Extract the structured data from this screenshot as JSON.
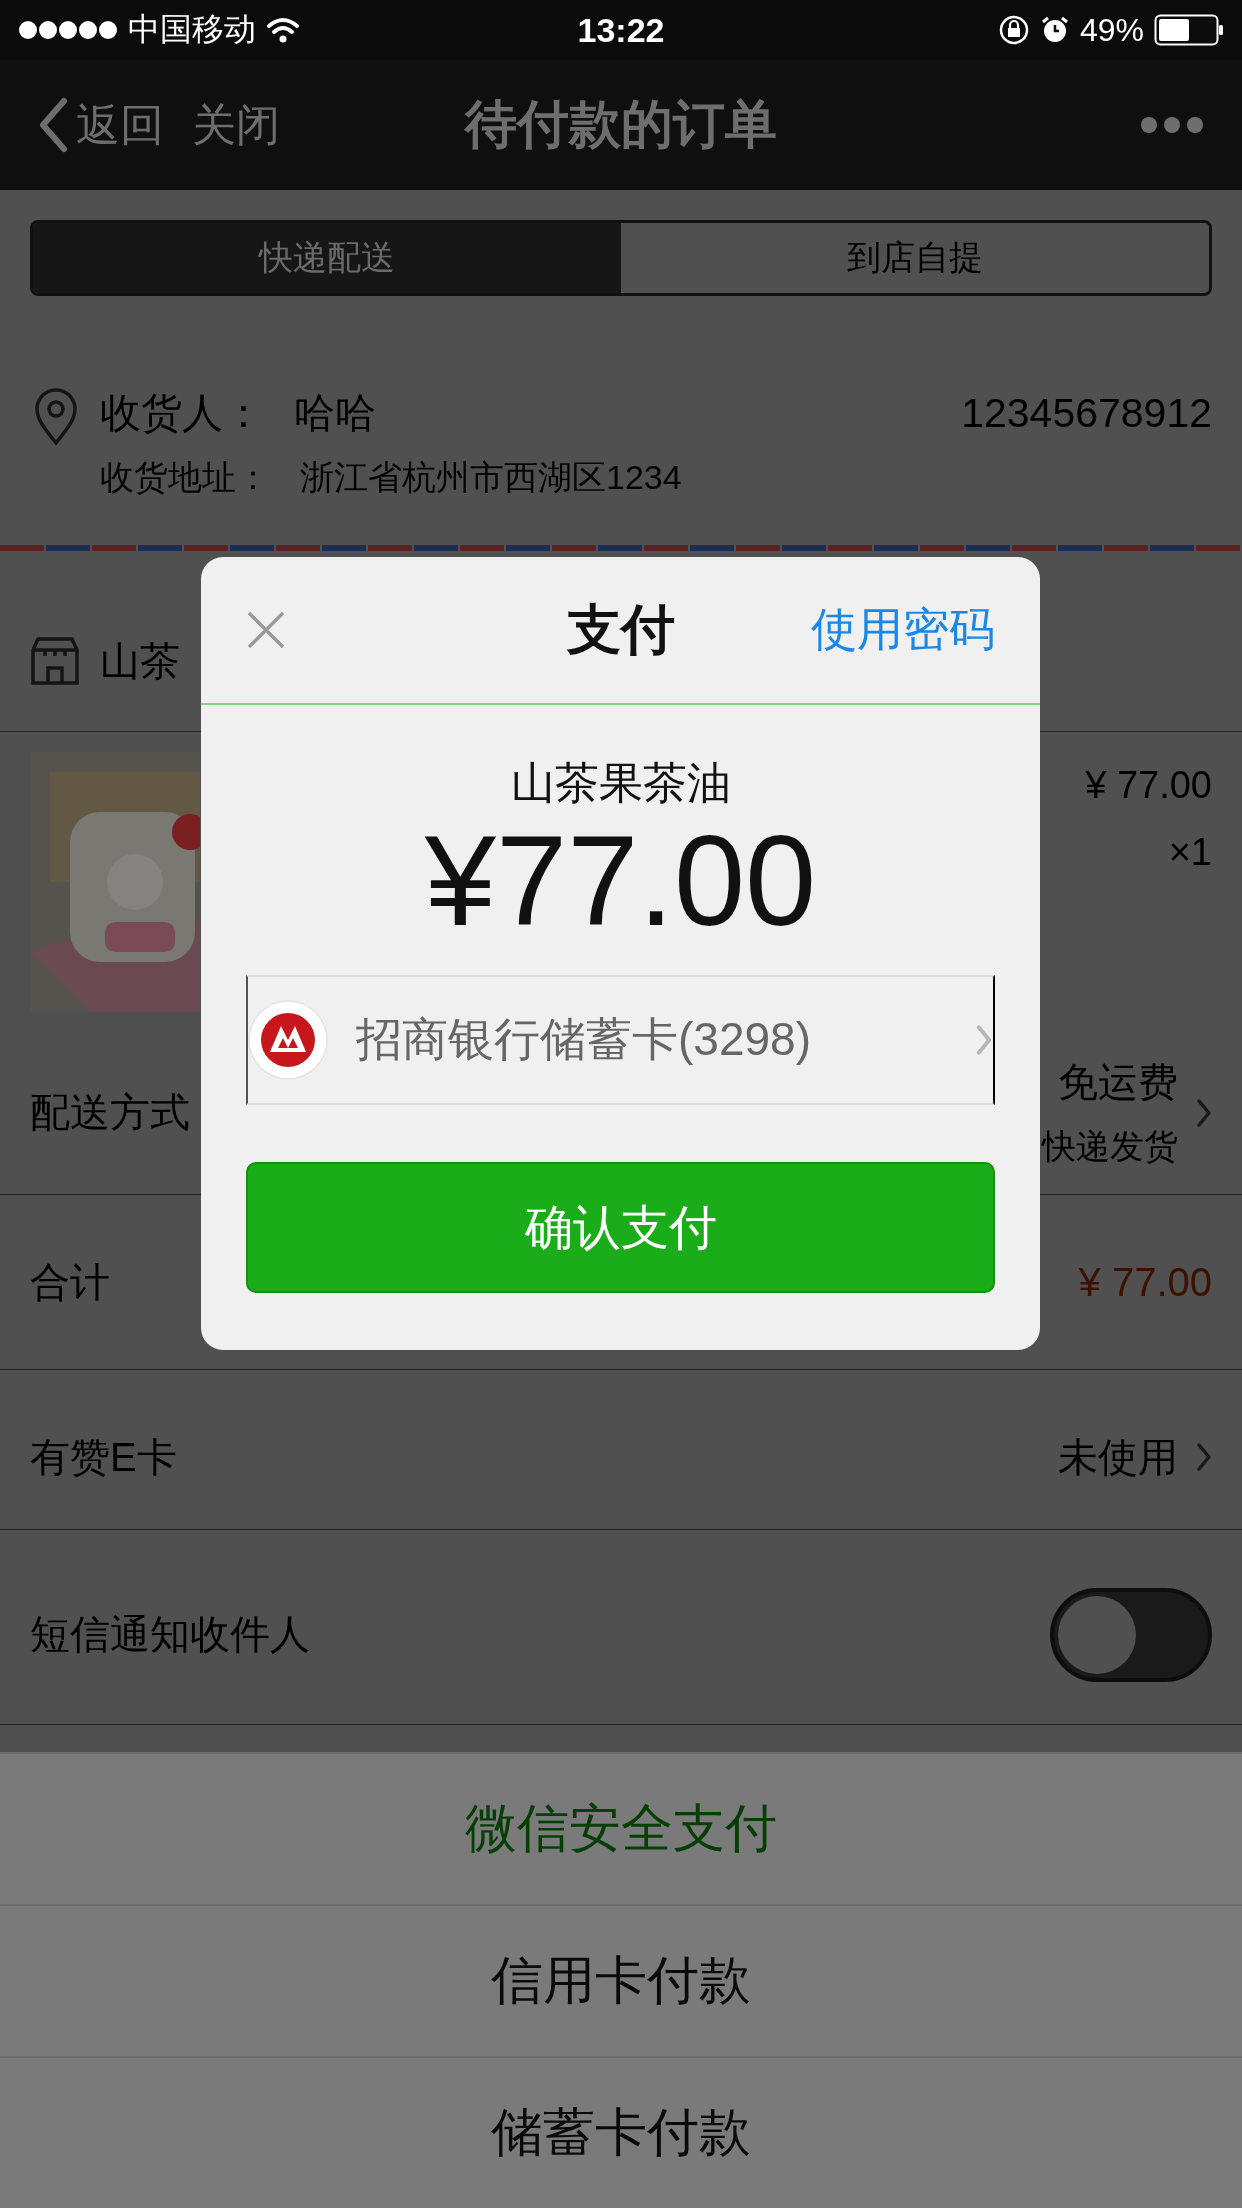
{
  "status_bar": {
    "carrier": "中国移动",
    "time": "13:22",
    "battery": "49%"
  },
  "nav": {
    "back": "返回",
    "close": "关闭",
    "title": "待付款的订单"
  },
  "delivery_tabs": [
    {
      "label": "快递配送",
      "selected": true
    },
    {
      "label": "到店自提",
      "selected": false
    }
  ],
  "recipient": {
    "label": "收货人：",
    "name": "哈哈",
    "phone": "12345678912",
    "address_label": "收货地址：",
    "address": "浙江省杭州市西湖区1234"
  },
  "shop": {
    "name": "山茶"
  },
  "product": {
    "price": "¥ 77.00",
    "quantity": "×1"
  },
  "rows": [
    {
      "kind": "shipping",
      "label": "配送方式",
      "value": "免运费",
      "note": "快递发货"
    },
    {
      "kind": "total",
      "label": "合计",
      "value": "¥ 77.00"
    },
    {
      "kind": "link",
      "label": "有赞E卡",
      "value": "未使用"
    },
    {
      "kind": "toggle",
      "label": "短信通知收件人",
      "on": false
    }
  ],
  "pay_dialog": {
    "title": "支付",
    "alt_action": "使用密码",
    "product": "山茶果茶油",
    "amount": "¥77.00",
    "card": "招商银行储蓄卡(3298)",
    "confirm": "确认支付"
  },
  "action_sheet": [
    {
      "label": "微信安全支付",
      "kind": "primary"
    },
    {
      "label": "信用卡付款",
      "kind": "normal"
    },
    {
      "label": "储蓄卡付款",
      "kind": "normal"
    }
  ]
}
